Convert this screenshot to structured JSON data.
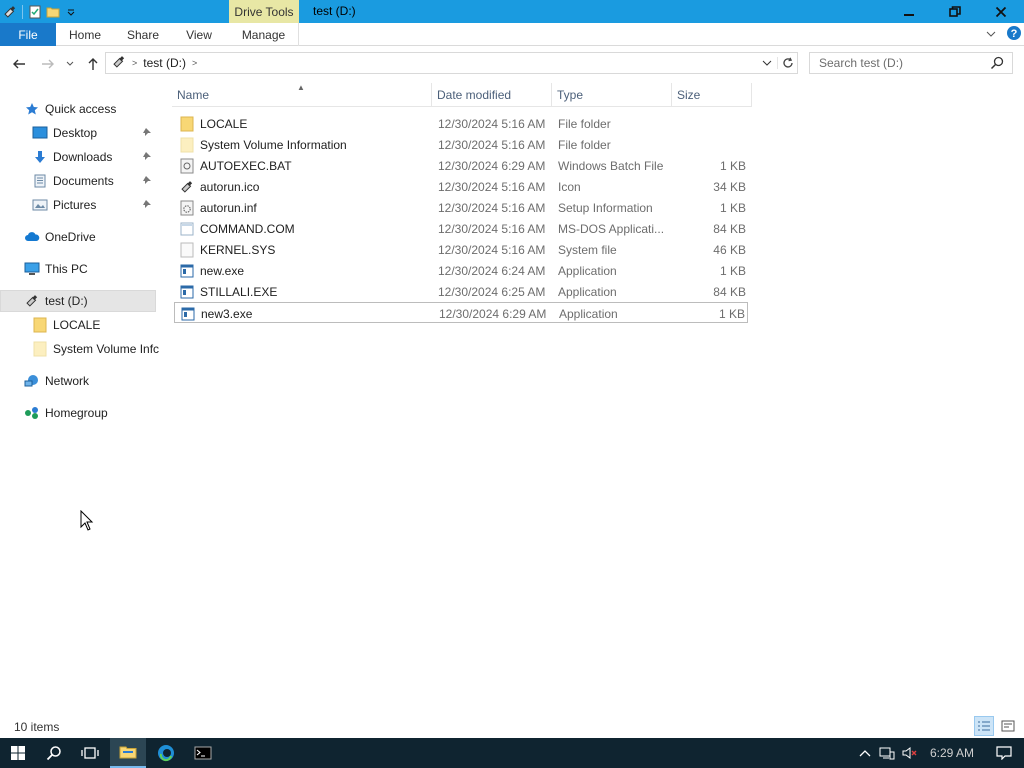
{
  "window": {
    "title": "test (D:)",
    "context_tab": "Drive Tools"
  },
  "ribbon": {
    "tabs": [
      "File",
      "Home",
      "Share",
      "View",
      "Manage"
    ]
  },
  "address": {
    "crumb": "test (D:)",
    "search_placeholder": "Search test (D:)"
  },
  "nav_pane": {
    "items": [
      {
        "label": "Quick access",
        "icon": "star-icon"
      },
      {
        "label": "Desktop",
        "icon": "desktop-icon",
        "pinned": true
      },
      {
        "label": "Downloads",
        "icon": "download-arrow-icon",
        "pinned": true
      },
      {
        "label": "Documents",
        "icon": "documents-icon",
        "pinned": true
      },
      {
        "label": "Pictures",
        "icon": "pictures-icon",
        "pinned": true
      },
      {
        "label": "OneDrive",
        "icon": "cloud-icon"
      },
      {
        "label": "This PC",
        "icon": "computer-icon"
      },
      {
        "label": "test (D:)",
        "icon": "usb-drive-icon",
        "selected": true
      },
      {
        "label": "LOCALE",
        "icon": "folder-icon"
      },
      {
        "label": "System Volume Infc",
        "icon": "folder-light-icon"
      },
      {
        "label": "Network",
        "icon": "network-icon"
      },
      {
        "label": "Homegroup",
        "icon": "homegroup-icon"
      }
    ]
  },
  "columns": [
    "Name",
    "Date modified",
    "Type",
    "Size"
  ],
  "files": [
    {
      "name": "LOCALE",
      "date": "12/30/2024 5:16 AM",
      "type": "File folder",
      "size": "",
      "icon": "folder-icon"
    },
    {
      "name": "System Volume Information",
      "date": "12/30/2024 5:16 AM",
      "type": "File folder",
      "size": "",
      "icon": "folder-light-icon"
    },
    {
      "name": "AUTOEXEC.BAT",
      "date": "12/30/2024 6:29 AM",
      "type": "Windows Batch File",
      "size": "1 KB",
      "icon": "batch-file-icon"
    },
    {
      "name": "autorun.ico",
      "date": "12/30/2024 5:16 AM",
      "type": "Icon",
      "size": "34 KB",
      "icon": "usb-drive-icon"
    },
    {
      "name": "autorun.inf",
      "date": "12/30/2024 5:16 AM",
      "type": "Setup Information",
      "size": "1 KB",
      "icon": "setup-file-icon"
    },
    {
      "name": "COMMAND.COM",
      "date": "12/30/2024 5:16 AM",
      "type": "MS-DOS Applicati...",
      "size": "84 KB",
      "icon": "dos-app-icon"
    },
    {
      "name": "KERNEL.SYS",
      "date": "12/30/2024 5:16 AM",
      "type": "System file",
      "size": "46 KB",
      "icon": "system-file-icon"
    },
    {
      "name": "new.exe",
      "date": "12/30/2024 6:24 AM",
      "type": "Application",
      "size": "1 KB",
      "icon": "application-icon"
    },
    {
      "name": "STILLALI.EXE",
      "date": "12/30/2024 6:25 AM",
      "type": "Application",
      "size": "84 KB",
      "icon": "application-icon"
    },
    {
      "name": "new3.exe",
      "date": "12/30/2024 6:29 AM",
      "type": "Application",
      "size": "1 KB",
      "icon": "application-icon",
      "focused": true
    }
  ],
  "status": {
    "item_count": "10 items"
  },
  "taskbar": {
    "clock": "6:29 AM"
  },
  "colors": {
    "titlebar": "#1a9be0",
    "file_tab": "#1979ca",
    "drive_tools": "#e8e7a5",
    "taskbar": "#0f2430"
  }
}
